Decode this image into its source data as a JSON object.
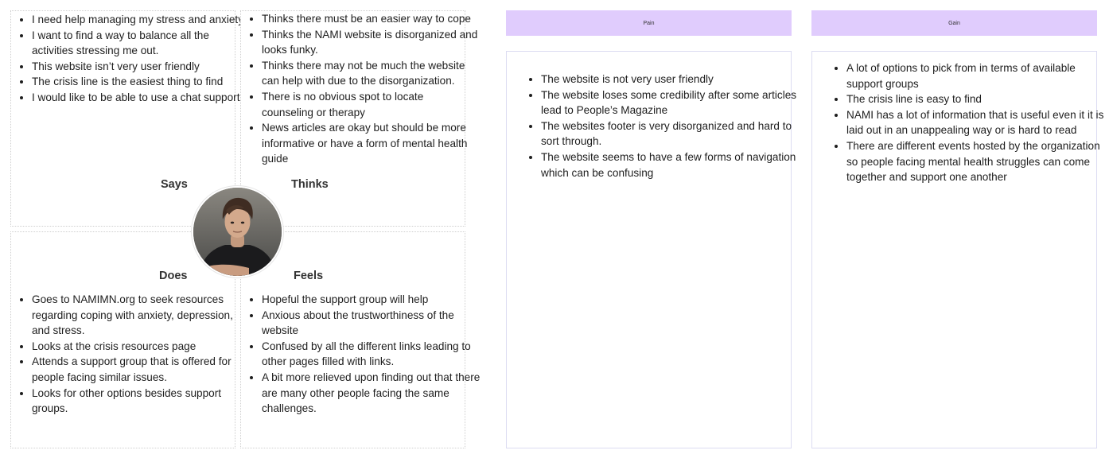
{
  "empathy_map": {
    "says": {
      "title": "Says",
      "items": [
        "I need help managing my stress and anxiety.",
        "I want to find a way to balance all the activities stressing me out.",
        "This website isn’t very user friendly",
        "The crisis line is the easiest thing to find",
        "I would like to be able to use a chat support"
      ]
    },
    "thinks": {
      "title": "Thinks",
      "items": [
        "Thinks there must be an easier way to cope",
        "Thinks the NAMI website is disorganized and looks funky.",
        "Thinks there may not be much the website can help with due to the disorganization.",
        "There is no obvious spot to locate counseling or therapy",
        "News articles are okay but should be more informative or have a form of mental health guide"
      ]
    },
    "does": {
      "title": "Does",
      "items": [
        "Goes to NAMIMN.org to seek resources regarding coping with anxiety, depression, and stress.",
        "Looks at the crisis resources page",
        "Attends a support group that is offered for people facing similar issues.",
        "Looks for other options besides support groups."
      ]
    },
    "feels": {
      "title": "Feels",
      "items": [
        "Hopeful the support group will help",
        "Anxious about the trustworthiness of the website",
        "Confused by all the different links leading to other pages filled with links.",
        "A bit more relieved upon finding out that there are many other people facing the same challenges."
      ]
    }
  },
  "pain": {
    "header": "Pain",
    "items": [
      "The website is not very user friendly",
      "The website loses some credibility after some articles lead to People’s Magazine",
      "The websites footer is very disorganized and hard to sort through.",
      "The website seems to have a few forms of navigation which can be confusing"
    ]
  },
  "gain": {
    "header": "Gain",
    "items": [
      "A lot of options to pick from in terms of available support groups",
      "The crisis line is easy to find",
      "NAMI has a lot of information that is useful even it it is laid out in an unappealing way or is hard to read",
      "There are different events hosted by the organization so people facing mental health struggles can come together and support one another"
    ]
  },
  "colors": {
    "header_fill": "#e0ccfd",
    "panel_border": "#dcdcf2",
    "quadrant_border": "#cfcfcf",
    "text": "#1e1e1e"
  },
  "avatar": {
    "icon": "person-photo-icon"
  }
}
